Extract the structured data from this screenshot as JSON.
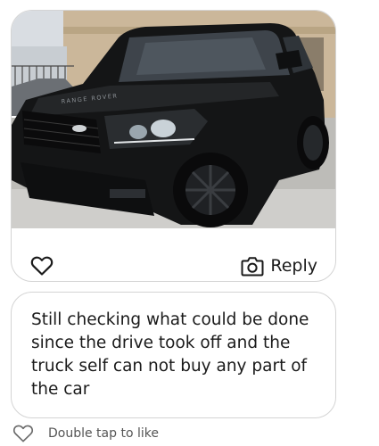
{
  "image_message": {
    "photo_badge_text": "RANGE ROVER",
    "like_icon": "heart-outline-icon",
    "reply_icon": "camera-icon",
    "reply_label": "Reply"
  },
  "text_message": {
    "body": "Still checking what could be done since the drive took off and the truck self can not buy any part of the car"
  },
  "footer": {
    "like_icon": "heart-outline-icon",
    "hint": "Double tap to like"
  },
  "colors": {
    "bubble_border": "#d4d4d4",
    "text": "#1a1a1a",
    "hint_text": "#555555"
  }
}
